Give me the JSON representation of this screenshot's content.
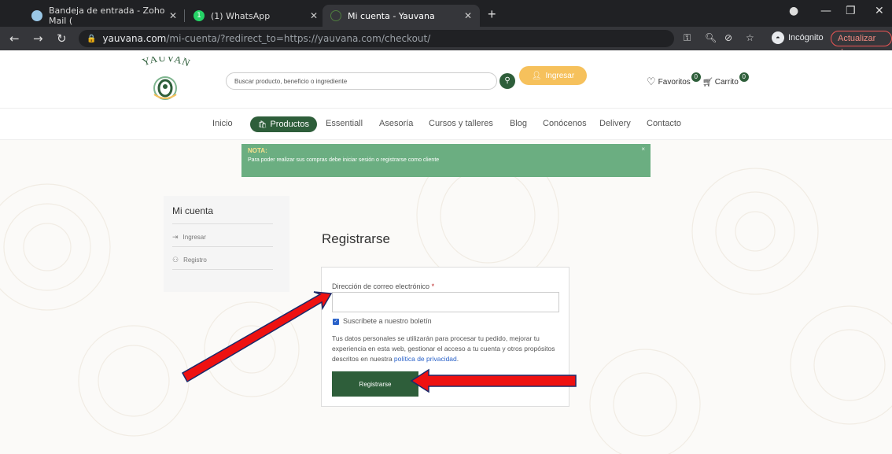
{
  "browser": {
    "tabs": [
      {
        "title": "Bandeja de entrada - Zoho Mail (",
        "favicon": "zoho-mail-icon"
      },
      {
        "title": "(1) WhatsApp",
        "favicon": "whatsapp-icon",
        "favicon_badge": "1"
      },
      {
        "title": "Mi cuenta - Yauvana",
        "favicon": "yauvana-icon",
        "active": true
      }
    ],
    "url_host": "yauvana.com",
    "url_path": "/mi-cuenta/?redirect_to=https://yauvana.com/checkout/",
    "incognito_label": "Incógnito",
    "update_label": "Actualizar"
  },
  "site": {
    "logo_text": "YAUVANA",
    "search_placeholder": "Buscar producto, beneficio o ingrediente",
    "login_label": "Ingresar",
    "favorites_label": "Favoritos",
    "favorites_count": "0",
    "cart_label": "Carrito",
    "cart_count": "0",
    "nav": [
      "Inicio",
      "Productos",
      "Essentiall",
      "Asesoría",
      "Cursos y talleres",
      "Blog",
      "Conócenos",
      "Delivery",
      "Contacto"
    ]
  },
  "notice": {
    "title": "NOTA:",
    "text": "Para poder realizar sus compras debe iniciar sesión o registrarse como cliente",
    "close": "×"
  },
  "account": {
    "title": "Mi cuenta",
    "links": [
      "Ingresar",
      "Registro"
    ]
  },
  "register": {
    "title": "Registrarse",
    "email_label": "Dirección de correo electrónico",
    "required_mark": "*",
    "email_value": "",
    "newsletter_label": "Suscríbete a nuestro boletín",
    "newsletter_checked": true,
    "privacy_text": "Tus datos personales se utilizarán para procesar tu pedido, mejorar tu experiencia en esta web, gestionar el acceso a tu cuenta y otros propósitos descritos en nuestra ",
    "privacy_link": "política de privacidad",
    "privacy_end": ".",
    "submit_label": "Registrarse"
  },
  "colors": {
    "brand_green": "#2e5e3a",
    "notice_green": "#6bae81",
    "login_yellow": "#f6c15c",
    "annotation_red": "#ee1111"
  }
}
